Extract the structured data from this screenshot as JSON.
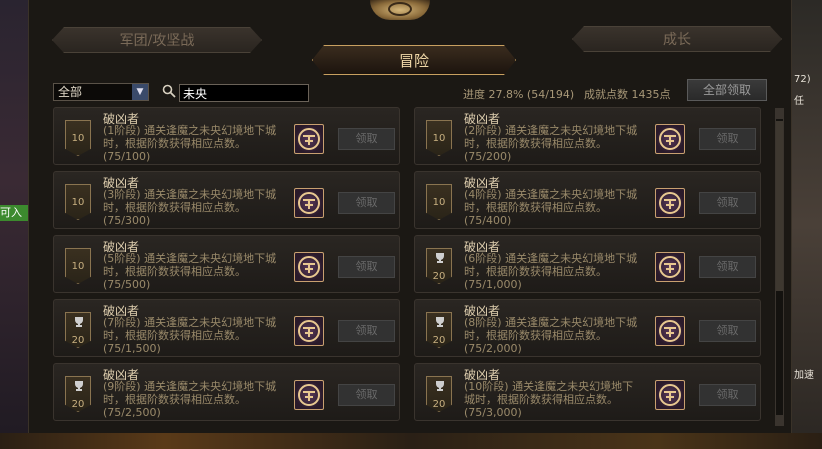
{
  "tabs": {
    "left": "军团/攻坚战",
    "active": "冒险",
    "right": "成长"
  },
  "filter": {
    "selected": "全部"
  },
  "search": {
    "value": "未央"
  },
  "stats": {
    "progress": "进度 27.8% (54/194)",
    "points": "成就点数 1435点"
  },
  "claim_all_label": "全部领取",
  "achievements": [
    {
      "title": "破凶者",
      "desc": "(1阶段) 通关逢魔之未央幻境地下城时，根据阶数获得相应点数。",
      "progress": "(75/100)",
      "medal": "10",
      "claim": "领取",
      "trophy": false
    },
    {
      "title": "破凶者",
      "desc": "(2阶段) 通关逢魔之未央幻境地下城时，根据阶数获得相应点数。",
      "progress": "(75/200)",
      "medal": "10",
      "claim": "领取",
      "trophy": false
    },
    {
      "title": "破凶者",
      "desc": "(3阶段) 通关逢魔之未央幻境地下城时，根据阶数获得相应点数。",
      "progress": "(75/300)",
      "medal": "10",
      "claim": "领取",
      "trophy": false
    },
    {
      "title": "破凶者",
      "desc": "(4阶段) 通关逢魔之未央幻境地下城时，根据阶数获得相应点数。",
      "progress": "(75/400)",
      "medal": "10",
      "claim": "领取",
      "trophy": false
    },
    {
      "title": "破凶者",
      "desc": "(5阶段) 通关逢魔之未央幻境地下城时，根据阶数获得相应点数。",
      "progress": "(75/500)",
      "medal": "10",
      "claim": "领取",
      "trophy": false
    },
    {
      "title": "破凶者",
      "desc": "(6阶段) 通关逢魔之未央幻境地下城时，根据阶数获得相应点数。",
      "progress": "(75/1,000)",
      "medal": "20",
      "claim": "领取",
      "trophy": true
    },
    {
      "title": "破凶者",
      "desc": "(7阶段) 通关逢魔之未央幻境地下城时，根据阶数获得相应点数。",
      "progress": "(75/1,500)",
      "medal": "20",
      "claim": "领取",
      "trophy": true
    },
    {
      "title": "破凶者",
      "desc": "(8阶段) 通关逢魔之未央幻境地下城时，根据阶数获得相应点数。",
      "progress": "(75/2,000)",
      "medal": "20",
      "claim": "领取",
      "trophy": true
    },
    {
      "title": "破凶者",
      "desc": "(9阶段) 通关逢魔之未央幻境地下城时，根据阶数获得相应点数。",
      "progress": "(75/2,500)",
      "medal": "20",
      "claim": "领取",
      "trophy": true
    },
    {
      "title": "破凶者",
      "desc": "(10阶段) 通关逢魔之未央幻境地下城时，根据阶数获得相应点数。",
      "progress": "(75/3,000)",
      "medal": "20",
      "claim": "领取",
      "trophy": true
    }
  ],
  "side_text": {
    "left_badge": "可入",
    "right_1": "72)",
    "right_2": "任",
    "right_3": "加速"
  },
  "icons": {
    "search": "search-icon",
    "dropdown": "chevron-down-icon",
    "trophy": "trophy-icon",
    "reward": "reward-chest-icon"
  }
}
